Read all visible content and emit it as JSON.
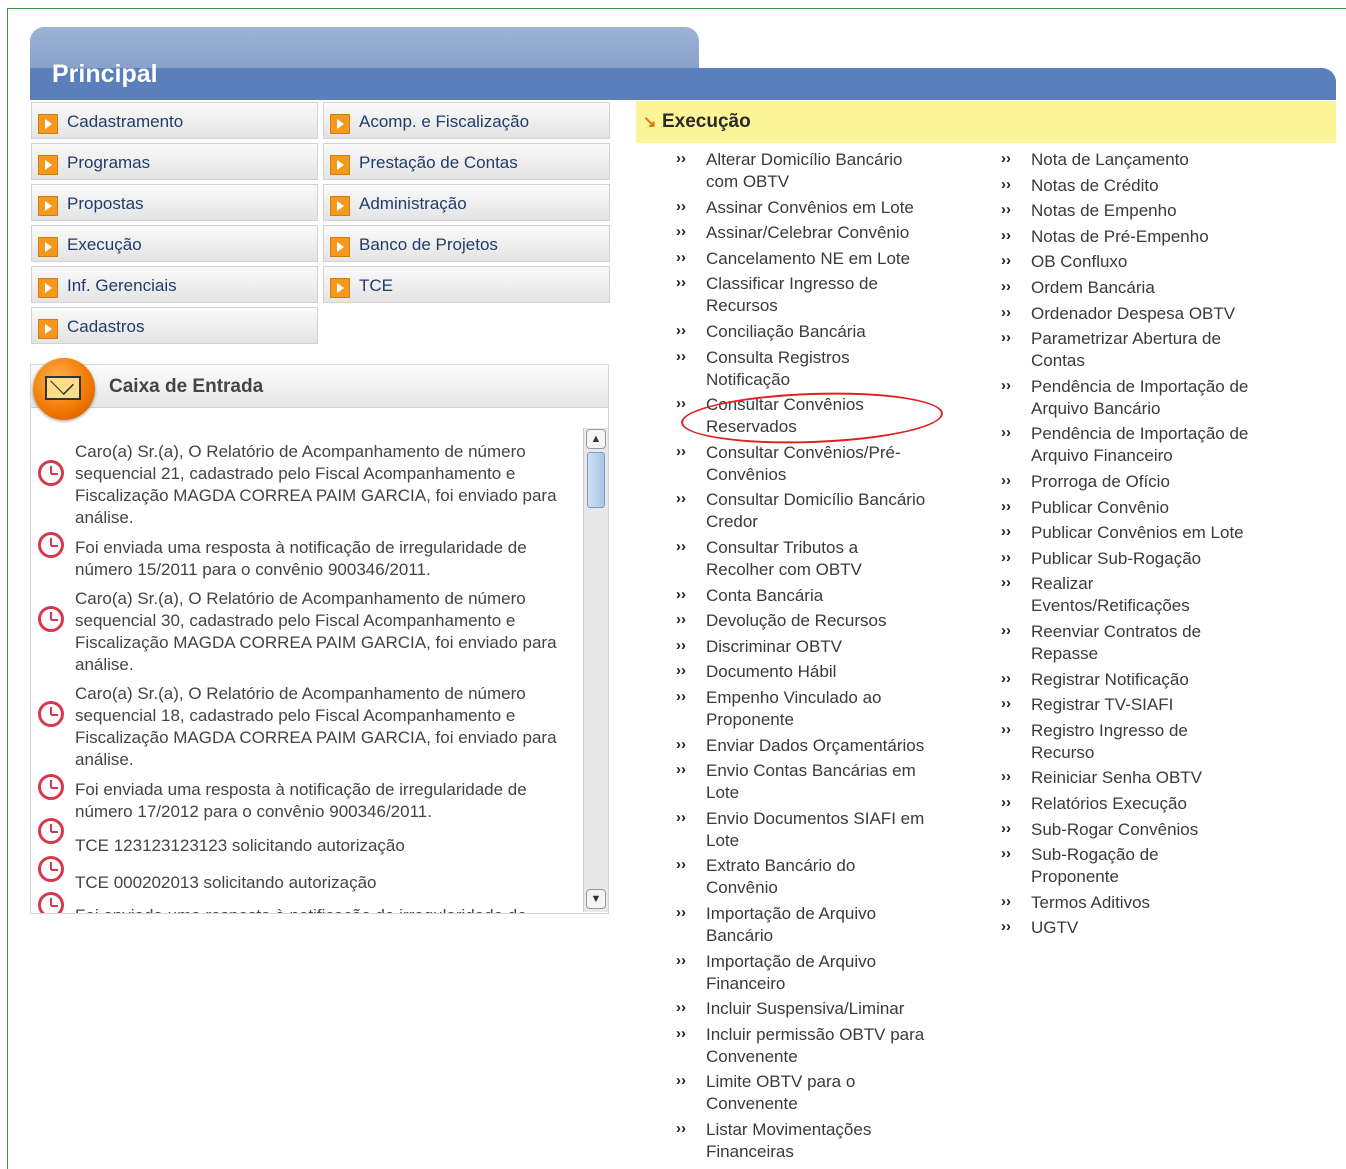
{
  "header": {
    "title": "Principal"
  },
  "menu": [
    "Cadastramento",
    "Acomp. e Fiscalização",
    "Programas",
    "Prestação de Contas",
    "Propostas",
    "Administração",
    "Execução",
    "Banco de Projetos",
    "Inf. Gerenciais",
    "TCE",
    "Cadastros"
  ],
  "inbox": {
    "title": "Caixa de Entrada",
    "messages": [
      "Caro(a) Sr.(a), O Relatório de Acompanhamento de número sequencial 21, cadastrado pelo Fiscal Acompanhamento e Fiscalização MAGDA CORREA PAIM GARCIA, foi enviado para análise.",
      "Foi enviada uma resposta à notificação de irregularidade de número 15/2011 para o convênio 900346/2011.",
      "Caro(a) Sr.(a), O Relatório de Acompanhamento de número sequencial 30, cadastrado pelo Fiscal Acompanhamento e Fiscalização MAGDA CORREA PAIM GARCIA, foi enviado para análise.",
      "Caro(a) Sr.(a), O Relatório de Acompanhamento de número sequencial 18, cadastrado pelo Fiscal Acompanhamento e Fiscalização MAGDA CORREA PAIM GARCIA, foi enviado para análise.",
      "Foi enviada uma resposta à notificação de irregularidade de número 17/2012 para o convênio 900346/2011.",
      "TCE 123123123123 solicitando autorização",
      "TCE 000202013 solicitando autorização",
      "Foi enviada uma resposta à notificação de irregularidade de"
    ]
  },
  "execucao": {
    "title": "Execução",
    "bullet": "››",
    "col1": [
      [
        "Alterar Domicílio Bancário",
        "com OBTV"
      ],
      [
        "Assinar Convênios em Lote"
      ],
      [
        "Assinar/Celebrar Convênio"
      ],
      [
        "Cancelamento NE em Lote"
      ],
      [
        "Classificar Ingresso de",
        "Recursos"
      ],
      [
        "Conciliação Bancária"
      ],
      [
        "Consulta Registros",
        "Notificação"
      ],
      [
        "Consultar Convênios",
        "Reservados"
      ],
      [
        "Consultar Convênios/Pré-",
        "Convênios"
      ],
      [
        "Consultar Domicílio Bancário",
        "Credor"
      ],
      [
        "Consultar Tributos a",
        "Recolher com OBTV"
      ],
      [
        "Conta Bancária"
      ],
      [
        "Devolução de Recursos"
      ],
      [
        "Discriminar OBTV"
      ],
      [
        "Documento Hábil"
      ],
      [
        "Empenho Vinculado ao",
        "Proponente"
      ],
      [
        "Enviar Dados Orçamentários"
      ],
      [
        "Envio Contas Bancárias em",
        "Lote"
      ],
      [
        "Envio Documentos SIAFI em",
        "Lote"
      ],
      [
        "Extrato Bancário do",
        "Convênio"
      ],
      [
        "Importação de Arquivo",
        "Bancário"
      ],
      [
        "Importação de Arquivo",
        "Financeiro"
      ],
      [
        "Incluir Suspensiva/Liminar"
      ],
      [
        "Incluir permissão OBTV para",
        "Convenente"
      ],
      [
        "Limite OBTV para o",
        "Convenente"
      ],
      [
        "Listar Movimentações",
        "Financeiras"
      ]
    ],
    "col2": [
      [
        "Nota de Lançamento"
      ],
      [
        "Notas de Crédito"
      ],
      [
        "Notas de Empenho"
      ],
      [
        "Notas de Pré-Empenho"
      ],
      [
        "OB Confluxo"
      ],
      [
        "Ordem Bancária"
      ],
      [
        "Ordenador Despesa OBTV"
      ],
      [
        "Parametrizar Abertura de",
        "Contas"
      ],
      [
        "Pendência de Importação de",
        "Arquivo Bancário"
      ],
      [
        "Pendência de Importação de",
        "Arquivo Financeiro"
      ],
      [
        "Prorroga de Ofício"
      ],
      [
        "Publicar Convênio"
      ],
      [
        "Publicar Convênios em Lote"
      ],
      [
        "Publicar Sub-Rogação"
      ],
      [
        "Realizar",
        "Eventos/Retificações"
      ],
      [
        "Reenviar Contratos de",
        "Repasse"
      ],
      [
        "Registrar Notificação"
      ],
      [
        "Registrar TV-SIAFI"
      ],
      [
        "Registro Ingresso de",
        "Recurso"
      ],
      [
        "Reiniciar Senha OBTV"
      ],
      [
        "Relatórios Execução"
      ],
      [
        "Sub-Rogar Convênios"
      ],
      [
        "Sub-Rogação de",
        "Proponente"
      ],
      [
        "Termos Aditivos"
      ],
      [
        "UGTV"
      ]
    ]
  },
  "colors": {
    "header_blue": "#5a7fba",
    "exec_bg": "#fbf598",
    "highlight": "#e02020"
  }
}
